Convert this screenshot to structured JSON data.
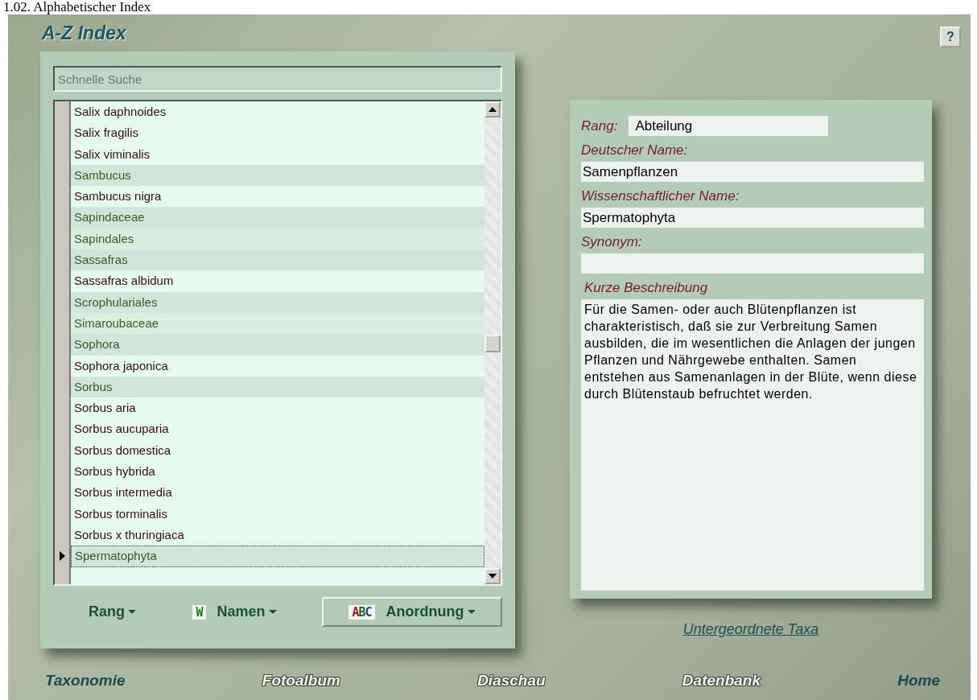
{
  "page_heading": "1.02. Alphabetischer Index",
  "window": {
    "title": "A-Z Index",
    "help_button": "?"
  },
  "search": {
    "placeholder": "Schnelle Suche"
  },
  "list": [
    {
      "label": "Salix daphnoides",
      "kind": "species",
      "selected": false
    },
    {
      "label": "Salix fragilis",
      "kind": "species",
      "selected": false
    },
    {
      "label": "Salix viminalis",
      "kind": "species",
      "selected": false
    },
    {
      "label": "Sambucus",
      "kind": "group",
      "selected": false
    },
    {
      "label": "Sambucus nigra",
      "kind": "species",
      "selected": false
    },
    {
      "label": "Sapindaceae",
      "kind": "group",
      "selected": false
    },
    {
      "label": "Sapindales",
      "kind": "group",
      "selected": false
    },
    {
      "label": "Sassafras",
      "kind": "group",
      "selected": false
    },
    {
      "label": "Sassafras albidum",
      "kind": "species",
      "selected": false
    },
    {
      "label": "Scrophulariales",
      "kind": "group",
      "selected": false
    },
    {
      "label": "Simaroubaceae",
      "kind": "group",
      "selected": false
    },
    {
      "label": "Sophora",
      "kind": "group",
      "selected": false
    },
    {
      "label": "Sophora japonica",
      "kind": "species",
      "selected": false
    },
    {
      "label": "Sorbus",
      "kind": "group",
      "selected": false
    },
    {
      "label": "Sorbus aria",
      "kind": "species",
      "selected": false
    },
    {
      "label": "Sorbus aucuparia",
      "kind": "species",
      "selected": false
    },
    {
      "label": "Sorbus domestica",
      "kind": "species",
      "selected": false
    },
    {
      "label": "Sorbus hybrida",
      "kind": "species",
      "selected": false
    },
    {
      "label": "Sorbus intermedia",
      "kind": "species",
      "selected": false
    },
    {
      "label": "Sorbus torminalis",
      "kind": "species",
      "selected": false
    },
    {
      "label": "Sorbus x thuringiaca",
      "kind": "species",
      "selected": false
    },
    {
      "label": "Spermatophyta",
      "kind": "group",
      "selected": true
    }
  ],
  "list_buttons": [
    {
      "label": "Rang",
      "selected": false
    },
    {
      "label": "Namen",
      "icon_text": "W",
      "selected": false
    },
    {
      "label": "Anordnung",
      "icon_text": "ABC",
      "selected": true
    }
  ],
  "details": {
    "rank_label": "Rang:",
    "rank_value": "Abteilung",
    "german_name_label": "Deutscher Name:",
    "german_name_value": "Samenpflanzen",
    "scientific_name_label": "Wissenschaftlicher Name:",
    "scientific_name_value": "Spermatophyta",
    "synonym_label": "Synonym:",
    "description_label": "Kurze Beschreibung",
    "description": "Für die Samen- oder auch Blütenpflanzen ist charakteristisch, daß sie zur Verbreitung Samen ausbilden, die im wesentlichen die Anlagen der jungen Pflanzen und Nährgewebe enthalten. Samen entstehen aus Samenanlagen in der Blüte, wenn diese durch Blütenstaub befruchtet werden."
  },
  "subtaxa_link": "Untergeordnete Taxa",
  "nav": [
    {
      "label": "Taxonomie",
      "disabled": false
    },
    {
      "label": "Fotoalbum",
      "disabled": true
    },
    {
      "label": "Diaschau",
      "disabled": true
    },
    {
      "label": "Datenbank",
      "disabled": true
    },
    {
      "label": "Home",
      "disabled": false
    }
  ]
}
